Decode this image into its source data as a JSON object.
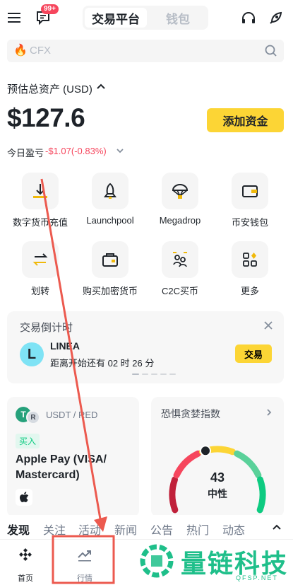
{
  "header": {
    "badge": "99+",
    "tabs": [
      {
        "label": "交易平台",
        "active": true
      },
      {
        "label": "钱包",
        "active": false
      }
    ],
    "icons": [
      "menu-icon",
      "message-icon",
      "headset-icon",
      "rocket-icon"
    ]
  },
  "search": {
    "placeholder": "CFX"
  },
  "account": {
    "estimated_label": "预估总资产 (USD)",
    "balance": "$127.6",
    "add_funds": "添加资金",
    "pnl_label": "今日盈亏",
    "pnl_value": "-$1.07(-0.83%)"
  },
  "shortcuts": [
    {
      "label": "数字货币充值",
      "icon": "deposit-icon"
    },
    {
      "label": "Launchpool",
      "icon": "rocket-icon"
    },
    {
      "label": "Megadrop",
      "icon": "parachute-icon"
    },
    {
      "label": "币安钱包",
      "icon": "wallet-icon"
    },
    {
      "label": "划转",
      "icon": "transfer-icon"
    },
    {
      "label": "购买加密货币",
      "icon": "buy-crypto-icon"
    },
    {
      "label": "C2C买币",
      "icon": "p2p-icon"
    },
    {
      "label": "更多",
      "icon": "more-icon"
    }
  ],
  "countdown": {
    "title": "交易倒计时",
    "token": "LINEA",
    "logo_letter": "L",
    "time_text": "距离开始还有 02 时 26 分",
    "trade_label": "交易"
  },
  "pay_card": {
    "pair": "USDT / RED",
    "pair_icon_text": "T",
    "pair_icon2_text": "R",
    "buy_badge": "买入",
    "title": "Apple Pay (VISA/ Mastercard)"
  },
  "fear_greed": {
    "title": "恐惧贪婪指数",
    "value": "43",
    "label": "中性",
    "level": 43
  },
  "discover_tabs": [
    "发现",
    "关注",
    "活动",
    "新闻",
    "公告",
    "热门",
    "动态"
  ],
  "bottom_nav": [
    {
      "label": "首页",
      "icon": "binance-logo-icon"
    },
    {
      "label": "行情",
      "icon": "market-trend-icon"
    }
  ],
  "watermark": {
    "text": "量链科技",
    "sub": "QFSP.NET"
  },
  "colors": {
    "accent": "#fcd535",
    "down": "#f6465d",
    "up": "#0ecb81",
    "annotation": "#ec5a4f"
  }
}
